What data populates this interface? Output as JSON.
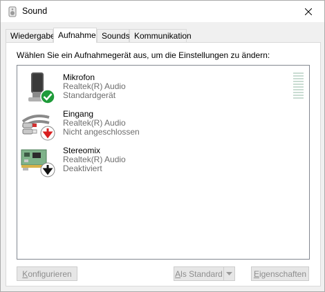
{
  "window": {
    "title": "Sound",
    "icon": "speaker-icon",
    "close_icon": "close-icon"
  },
  "tabs": [
    {
      "label": "Wiedergabe",
      "active": false
    },
    {
      "label": "Aufnahme",
      "active": true
    },
    {
      "label": "Sounds",
      "active": false
    },
    {
      "label": "Kommunikation",
      "active": false
    }
  ],
  "instruction": "Wählen Sie ein Aufnahmegerät aus, um die Einstellungen zu ändern:",
  "devices": [
    {
      "name": "Mikrofon",
      "driver": "Realtek(R) Audio",
      "status": "Standardgerät",
      "icon": "microphone-icon",
      "badge": "green-check-icon"
    },
    {
      "name": "Eingang",
      "driver": "Realtek(R) Audio",
      "status": "Nicht angeschlossen",
      "icon": "line-in-cable-icon",
      "badge": "red-down-arrow-icon"
    },
    {
      "name": "Stereomix",
      "driver": "Realtek(R) Audio",
      "status": "Deaktiviert",
      "icon": "sound-card-icon",
      "badge": "black-down-arrow-icon"
    }
  ],
  "level_meter": {
    "level": 0
  },
  "buttons": {
    "configure": {
      "mnemonic": "K",
      "rest": "onfigurieren"
    },
    "set_default": {
      "mnemonic": "A",
      "rest": "ls Standard"
    },
    "properties": {
      "mnemonic": "E",
      "rest": "igenschaften"
    }
  },
  "colors": {
    "check_green": "#1f9b3a",
    "arrow_red": "#d82020",
    "listbox_border": "#828790",
    "disabled_text": "#8d8d8d"
  }
}
